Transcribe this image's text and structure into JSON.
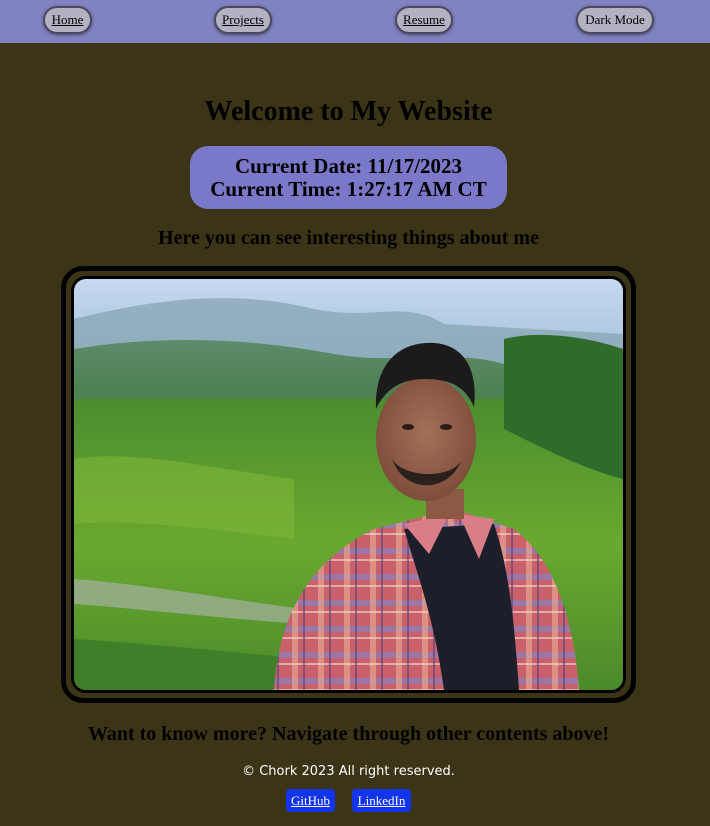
{
  "nav": {
    "home": "Home",
    "projects": "Projects",
    "resume": "Resume",
    "dark_mode": "Dark Mode"
  },
  "main": {
    "title": "Welcome to My Website",
    "current_date": "Current Date: 11/17/2023",
    "current_time": "Current Time: 1:27:17 AM CT",
    "subtitle": "Here you can see interesting things about me",
    "closing": "Want to know more? Navigate through other contents above!"
  },
  "footer": {
    "copyright": "© Chork 2023 All right reserved.",
    "github": "GitHub",
    "linkedin": "LinkedIn"
  },
  "colors": {
    "page_background": "#3b3416",
    "navbar": "#8182c1",
    "datetime_box": "#7a79c9",
    "social_button": "#1234ee"
  }
}
